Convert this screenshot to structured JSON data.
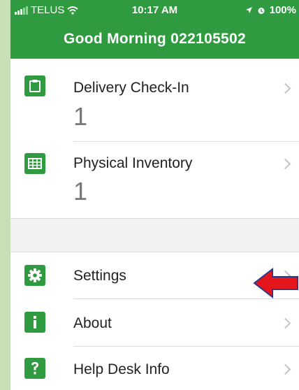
{
  "status_bar": {
    "carrier": "TELUS",
    "time": "10:17 AM",
    "battery": "100%"
  },
  "header": {
    "greeting": "Good Morning 022105502"
  },
  "tasks": [
    {
      "label": "Delivery Check-In",
      "count": "1",
      "icon": "clipboard-icon"
    },
    {
      "label": "Physical Inventory",
      "count": "1",
      "icon": "inventory-grid-icon"
    }
  ],
  "menu": [
    {
      "label": "Settings",
      "icon": "gear-icon"
    },
    {
      "label": "About",
      "icon": "info-icon"
    },
    {
      "label": "Help Desk Info",
      "icon": "question-icon"
    }
  ],
  "colors": {
    "brand_green": "#2f9a3f",
    "annotation_arrow": "#e2161b"
  }
}
